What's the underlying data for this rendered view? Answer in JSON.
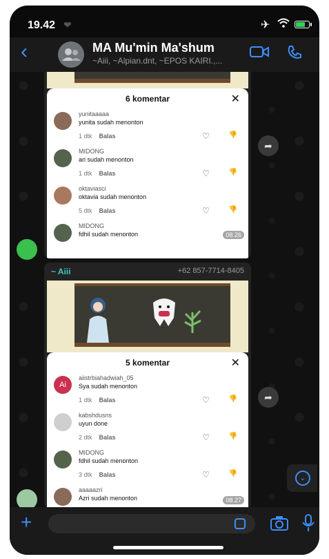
{
  "status": {
    "time": "19.42",
    "heart": "❤"
  },
  "header": {
    "back": "‹",
    "title": "MA Mu'min Ma'shum",
    "subtitle": "~Aiii, ~Alpian.dnt, ~EPOS KAIRI.,..."
  },
  "messages": [
    {
      "panel_title": "6 komentar",
      "close": "✕",
      "timestamp": "08.26",
      "comments": [
        {
          "name": "yunitaaaaa",
          "text": "yunita sudah menonton",
          "time": "1 dtk",
          "reply": "Balas"
        },
        {
          "name": "MIDONG",
          "text": "ari sudah menonton",
          "time": "1 dtk",
          "reply": "Balas"
        },
        {
          "name": "oktaviasci",
          "text": "oktavia sudah menonton",
          "time": "5 dtk",
          "reply": "Balas"
        },
        {
          "name": "MIDONG",
          "text": "fdhil sudah menonton",
          "time": "",
          "reply": ""
        }
      ]
    },
    {
      "sender": "~ Aiii",
      "phone": "+62 857-7714-8405",
      "panel_title": "5 komentar",
      "close": "✕",
      "timestamp": "08.27",
      "comments": [
        {
          "name": "aiistrbiahadwiah_05",
          "text": "Sya sudah menonton",
          "time": "1 dtk",
          "reply": "Balas",
          "avatar": "Ai"
        },
        {
          "name": "kabshdusns",
          "text": "uyun done",
          "time": "2 dtk",
          "reply": "Balas"
        },
        {
          "name": "MIDONG",
          "text": "fdhil sudah menonton",
          "time": "3 dtk",
          "reply": "Balas"
        },
        {
          "name": "aaaaazri",
          "text": "Azri sudah menonton",
          "time": "",
          "reply": ""
        }
      ]
    }
  ],
  "icons": {
    "heart": "♡",
    "dislike": "👎"
  },
  "colors": {
    "accent": "#3e8ef7",
    "sender": "#42c9c2"
  }
}
